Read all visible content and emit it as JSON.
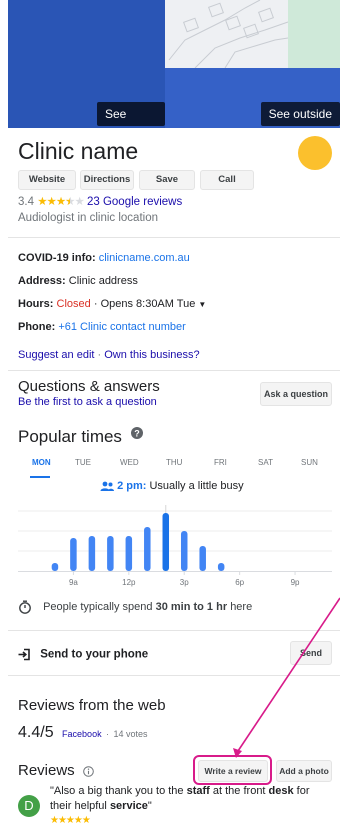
{
  "hero": {
    "see_photos": "See photos",
    "see_outside": "See outside"
  },
  "business": {
    "name": "Clinic name",
    "rating": "3.4",
    "stars_filled": 3.5,
    "reviews_link": "23 Google reviews",
    "category": "Audiologist in clinic location"
  },
  "actions": {
    "website": "Website",
    "directions": "Directions",
    "save": "Save",
    "call": "Call"
  },
  "info": {
    "covid_label": "COVID-19 info:",
    "covid_link": "clinicname.com.au",
    "address_label": "Address:",
    "address_value": "Clinic address",
    "hours_label": "Hours:",
    "hours_status": "Closed",
    "hours_sep": "·",
    "hours_next": "Opens 8:30AM Tue",
    "phone_label": "Phone:",
    "phone_value": "+61 Clinic contact number",
    "suggest_edit": "Suggest an edit",
    "own_business": "Own this business?",
    "link_sep": "·"
  },
  "qa": {
    "title": "Questions & answers",
    "subtitle": "Be the first to ask a question",
    "ask_button": "Ask a question"
  },
  "popular_times": {
    "title": "Popular times",
    "days": [
      "MON",
      "TUE",
      "WED",
      "THU",
      "FRI",
      "SAT",
      "SUN"
    ],
    "selected_day": "MON",
    "busy_time": "2 pm:",
    "busy_text": "Usually a little busy",
    "visit_prefix": "People typically spend",
    "visit_duration": "30 min to 1 hr",
    "visit_suffix": "here"
  },
  "chart_data": {
    "type": "bar",
    "categories": [
      "9a",
      "10a",
      "11a",
      "12p",
      "1p",
      "2p",
      "3p",
      "4p",
      "5p"
    ],
    "values": [
      8,
      33,
      35,
      35,
      35,
      44,
      58,
      40,
      25,
      8
    ],
    "x_hours": [
      8,
      9,
      10,
      11,
      12,
      13,
      14,
      15,
      16,
      17
    ],
    "xtick_labels": [
      "9a",
      "12p",
      "3p",
      "6p",
      "9p"
    ],
    "xtick_hours": [
      9,
      12,
      15,
      18,
      21
    ],
    "highlight_hour": 14,
    "x_range": [
      6,
      23
    ],
    "ylim": [
      0,
      60
    ],
    "color": "#4285f4",
    "highlight_color": "#1a73e8"
  },
  "send": {
    "label": "Send to your phone",
    "button": "Send"
  },
  "web_reviews": {
    "title": "Reviews from the web",
    "score": "4.4/5",
    "source": "Facebook",
    "sep": "·",
    "votes": "14 votes"
  },
  "reviews": {
    "title": "Reviews",
    "write_button": "Write a review",
    "photo_button": "Add a photo",
    "avatar_letter": "D",
    "snippet_1": "\"Also a big thank you to the ",
    "snippet_b1": "staff",
    "snippet_2": " at the front ",
    "snippet_b2": "desk",
    "snippet_3": " for their helpful ",
    "snippet_b3": "service",
    "snippet_4": "\"",
    "stars": "★★★★★"
  },
  "colors": {
    "accent": "#1a73e8",
    "link": "#1a0dab",
    "star": "#fbbc04",
    "annotation": "#d81b8a"
  }
}
